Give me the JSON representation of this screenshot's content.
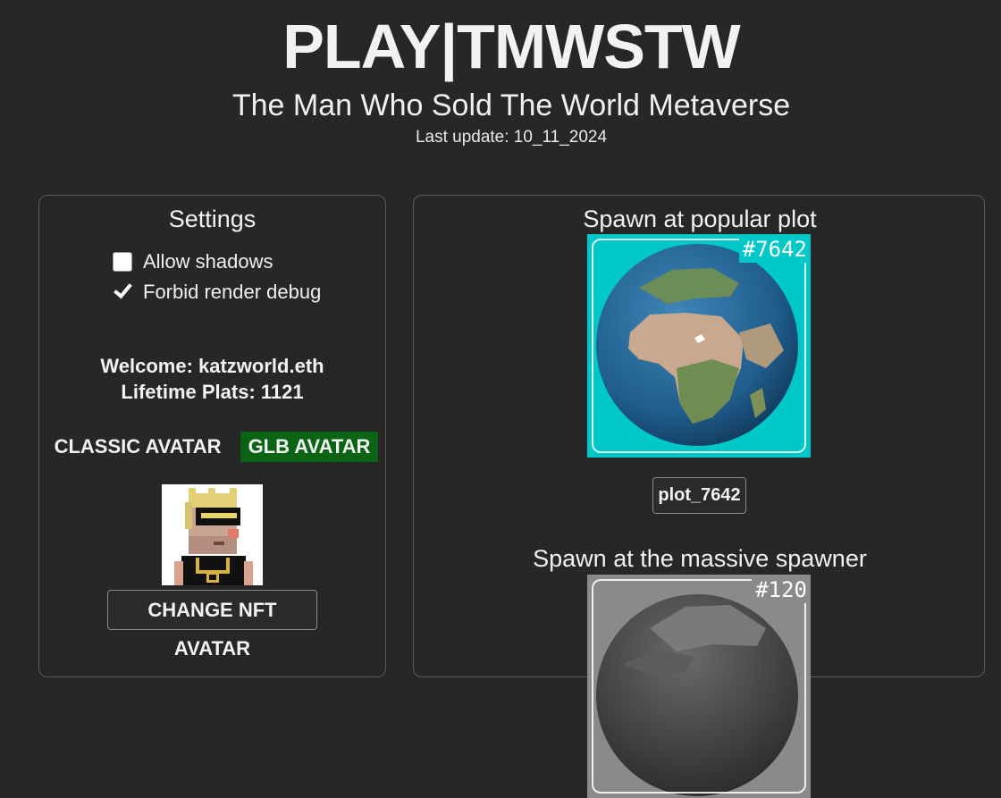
{
  "header": {
    "title": "PLAY|TMWSTW",
    "subtitle": "The Man Who Sold The World Metaverse",
    "last_update": "Last update: 10_11_2024"
  },
  "settings": {
    "heading": "Settings",
    "options": [
      {
        "label": "Allow shadows",
        "checked": false
      },
      {
        "label": "Forbid render debug",
        "checked": true
      }
    ],
    "welcome": "Welcome: katzworld.eth",
    "lifetime_plats": "Lifetime Plats: 1121",
    "avatar_tabs": [
      {
        "label": "CLASSIC AVATAR",
        "active": false
      },
      {
        "label": "GLB AVATAR",
        "active": true
      }
    ],
    "change_avatar_label": "CHANGE NFT AVATAR"
  },
  "spawn": {
    "popular": {
      "heading": "Spawn at popular plot",
      "plot_number": "#7642",
      "button_label": "plot_7642",
      "bg_color": "#00c8c8"
    },
    "massive": {
      "heading": "Spawn at the massive spawner",
      "plot_number": "#120",
      "bg_color": "#8a8a8a"
    }
  }
}
